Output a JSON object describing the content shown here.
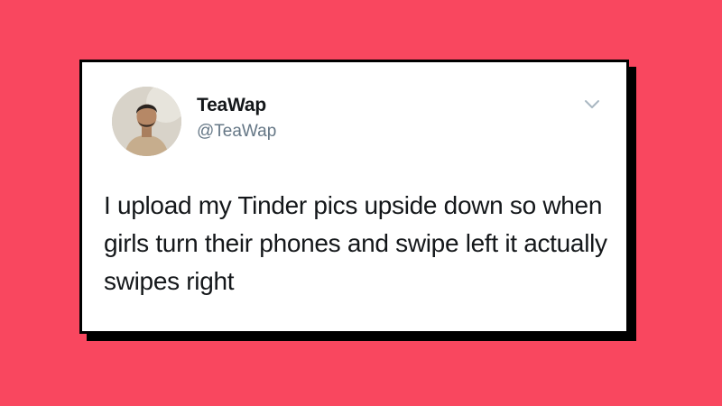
{
  "background_color": "#f9475f",
  "tweet": {
    "display_name": "TeaWap",
    "handle": "@TeaWap",
    "text": "I upload my Tinder pics upside down so when girls turn their phones and swipe left it actually swipes right",
    "avatar_icon": "profile-photo",
    "menu_icon": "chevron-down-icon"
  },
  "colors": {
    "text_primary": "#14171a",
    "text_secondary": "#657786",
    "card_border": "#000000"
  }
}
